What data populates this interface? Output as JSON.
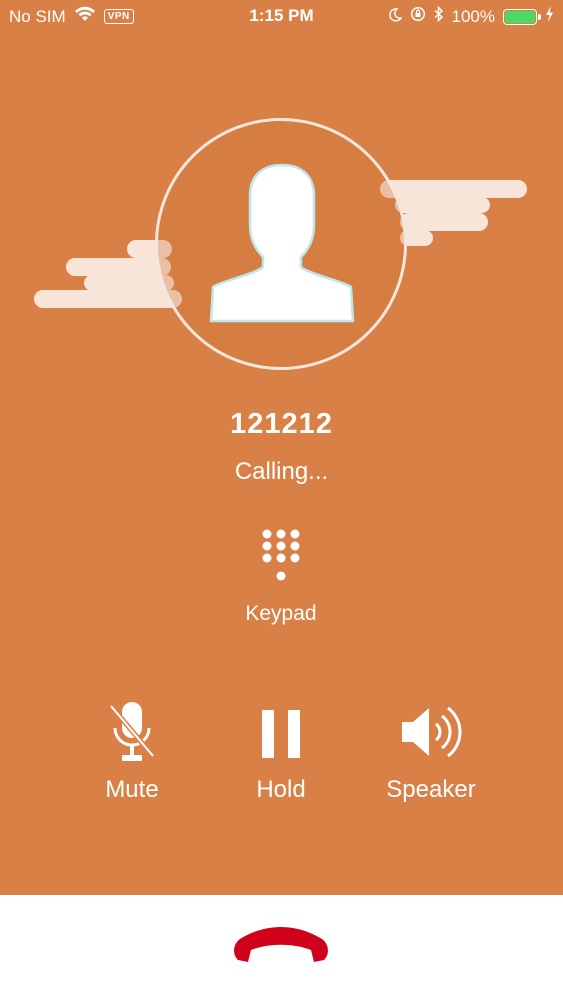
{
  "status_bar": {
    "carrier": "No SIM",
    "vpn": "VPN",
    "time": "1:15 PM",
    "battery": "100%",
    "battery_color": "#4cd964"
  },
  "call": {
    "number": "121212",
    "status": "Calling..."
  },
  "keypad": {
    "label": "Keypad",
    "icon": "dialpad-icon"
  },
  "controls": {
    "mute": {
      "label": "Mute",
      "icon": "mic-off-icon"
    },
    "hold": {
      "label": "Hold",
      "icon": "pause-icon"
    },
    "speaker": {
      "label": "Speaker",
      "icon": "speaker-icon"
    }
  },
  "end_call": {
    "icon": "phone-hangup-icon",
    "color": "#d0021b"
  },
  "colors": {
    "background": "#d98046",
    "text": "#ffffff"
  }
}
